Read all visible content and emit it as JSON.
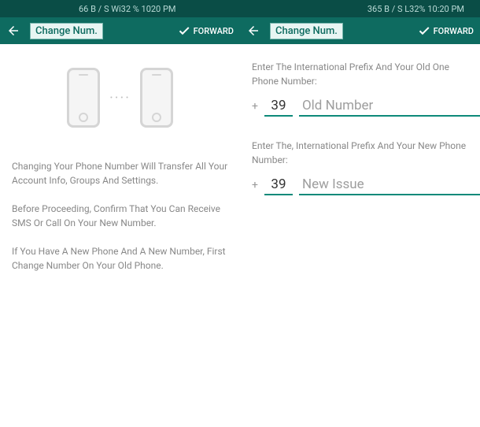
{
  "status": {
    "left": "66 B / S Wi32 % 1020 PM",
    "right": "365 B / S L32% 10:20 PM"
  },
  "appbar": {
    "left_title": "Change Num.",
    "right_title": "Change Num.",
    "forward_label_left": "FORWARD",
    "forward_label_right": "FORWARD"
  },
  "left_panel": {
    "para1": "Changing Your Phone Number Will Transfer All Your Account Info, Groups And Settings.",
    "para2": "Before Proceeding, Confirm That You Can Receive SMS Or Call On Your New Number.",
    "para3": "If You Have A New Phone And A New Number, First Change Number On Your Old Phone."
  },
  "right_panel": {
    "old_label": "Enter The International Prefix And Your Old One Phone Number:",
    "new_label": "Enter The, International Prefix And Your New Phone Number:",
    "old_prefix": "39",
    "new_prefix": "39",
    "old_placeholder": "Old Number",
    "new_placeholder": "New Issue",
    "plus": "+"
  }
}
